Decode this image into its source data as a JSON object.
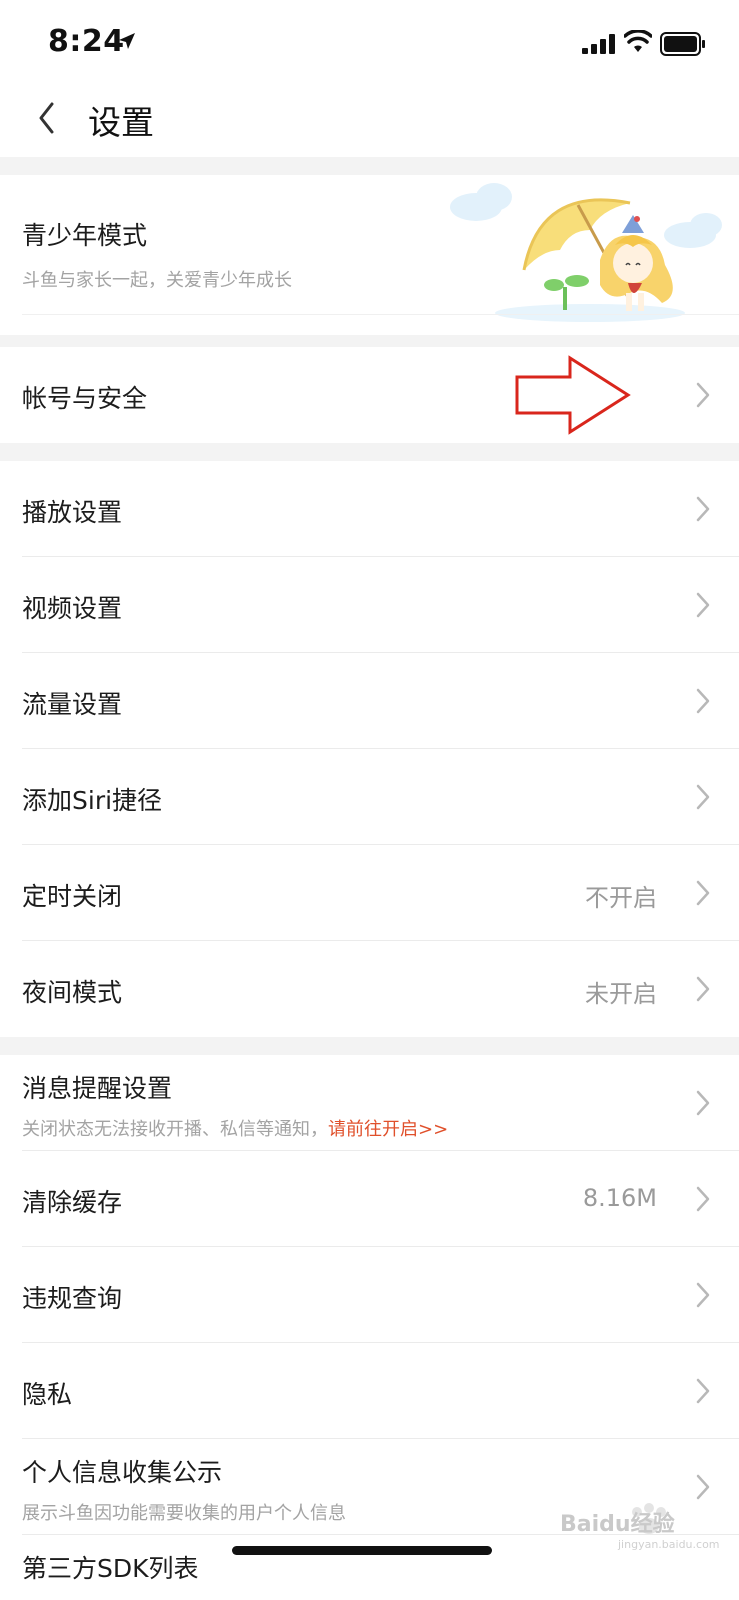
{
  "status_bar": {
    "time": "8:24"
  },
  "nav": {
    "title": "设置"
  },
  "teen_mode": {
    "title": "青少年模式",
    "subtitle": "斗鱼与家长一起，关爱青少年成长"
  },
  "account": {
    "label": "帐号与安全"
  },
  "group1": [
    {
      "label": "播放设置",
      "value": ""
    },
    {
      "label": "视频设置",
      "value": ""
    },
    {
      "label": "流量设置",
      "value": ""
    },
    {
      "label": "添加Siri捷径",
      "value": ""
    },
    {
      "label": "定时关闭",
      "value": "不开启"
    },
    {
      "label": "夜间模式",
      "value": "未开启"
    }
  ],
  "notify": {
    "label": "消息提醒设置",
    "sub_text": "关闭状态无法接收开播、私信等通知，",
    "sub_link": "请前往开启>>"
  },
  "group2": [
    {
      "label": "清除缓存",
      "value": "8.16M"
    },
    {
      "label": "违规查询",
      "value": ""
    },
    {
      "label": "隐私",
      "value": ""
    }
  ],
  "personal_info": {
    "label": "个人信息收集公示",
    "sub": "展示斗鱼因功能需要收集的用户个人信息"
  },
  "sdk": {
    "label": "第三方SDK列表"
  },
  "watermark": {
    "text": "Baidu经验",
    "sub": "jingyan.baidu.com"
  },
  "colors": {
    "link": "#e0502b",
    "annotation_arrow": "#d9261c",
    "section_gap": "#f3f3f3"
  }
}
